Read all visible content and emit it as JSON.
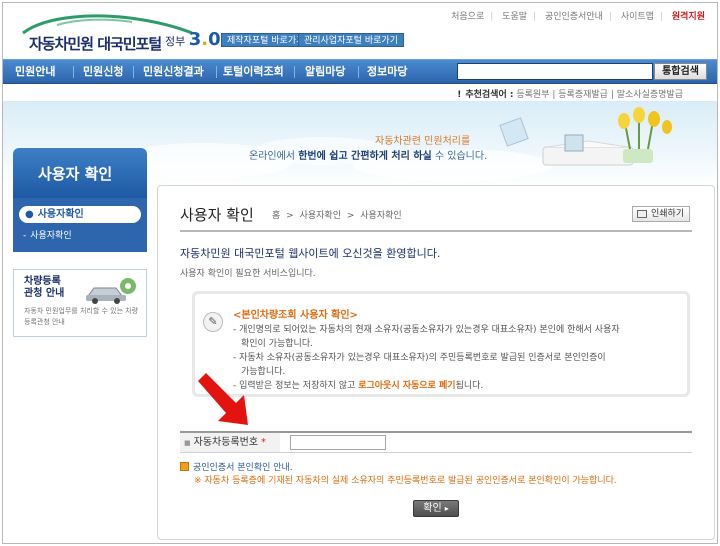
{
  "header": {
    "logo_text": "자동차민원 대국민포털",
    "gov_label": "정부",
    "gov_version_a": "3",
    "gov_version_dot": ".",
    "gov_version_b": "0",
    "btn_maker": "제작자포털 바로가기",
    "btn_admin": "관리사업자포털 바로가기",
    "utility_links": [
      "처음으로",
      "도움말",
      "공인인증서안내",
      "사이트맵"
    ],
    "remote_support": "원격지원"
  },
  "nav": {
    "items": [
      "민원안내",
      "민원신청",
      "민원신청결과",
      "토털이력조회",
      "알림마당",
      "정보마당"
    ],
    "search_placeholder": "",
    "search_button": "통합검색"
  },
  "recommend": {
    "label": "추천검색어 :",
    "keywords": [
      "등록원부",
      "등록증재발급",
      "말소사실증명발급"
    ]
  },
  "banner": {
    "line1": "자동차관련 민원처리를",
    "line2_pre": "온라인에서 ",
    "line2_hl": "한번에 쉽고 간편하게 처리 하실",
    "line2_post": " 수 있습니다."
  },
  "sidebar": {
    "title": "사용자 확인",
    "active_item": "사용자확인",
    "sub_item": "사용자확인",
    "guide_title_1": "차량등록",
    "guide_title_2": "관청 안내",
    "guide_desc": "자동차 민원업무를 처리할 수 있는 차량등록관청 안내"
  },
  "content": {
    "title": "사용자 확인",
    "breadcrumb": [
      "홈",
      ">",
      "사용자확인",
      ">",
      "사용자확인"
    ],
    "print_label": "인쇄하기",
    "welcome": "자동차민원 대국민포털 웹사이트에 오신것을 환영합니다.",
    "service_note": "사용자 확인이 필요한 서비스입니다.",
    "notice": {
      "heading": "<본인차량조회 사용자 확인>",
      "line1": "- 개인명의로 되어있는 자동차의 현재 소유자(공동소유자가 있는경우 대표소유자) 본인에 한해서 사용자",
      "line1b": "확인이 가능합니다.",
      "line2": "- 자동차 소유자(공동소유자가 있는경우 대표소유자)의 주민등록번호로 발급된 인증서로 본인인증이",
      "line2b": "가능합니다.",
      "line3_pre": "- 입력받은 정보는 저장하지 않고 ",
      "line3_em": "로그아웃시 자동으로 폐기",
      "line3_post": "됩니다."
    },
    "field_label": "자동차등록번호",
    "field_required": "*",
    "field_value": "",
    "info1": "공인인증서 본인확인 안내.",
    "info2": "※ 자동차 등록증에 기재된 자동차의 실제 소유자의 주민등록번호로 발급된 공인인증서로 본인확인이 가능합니다.",
    "confirm_label": "확인"
  },
  "colors": {
    "nav_blue": "#2c64ac",
    "accent_orange": "#e06a12",
    "arrow_red": "#e3140f",
    "required_red": "#e02020"
  }
}
